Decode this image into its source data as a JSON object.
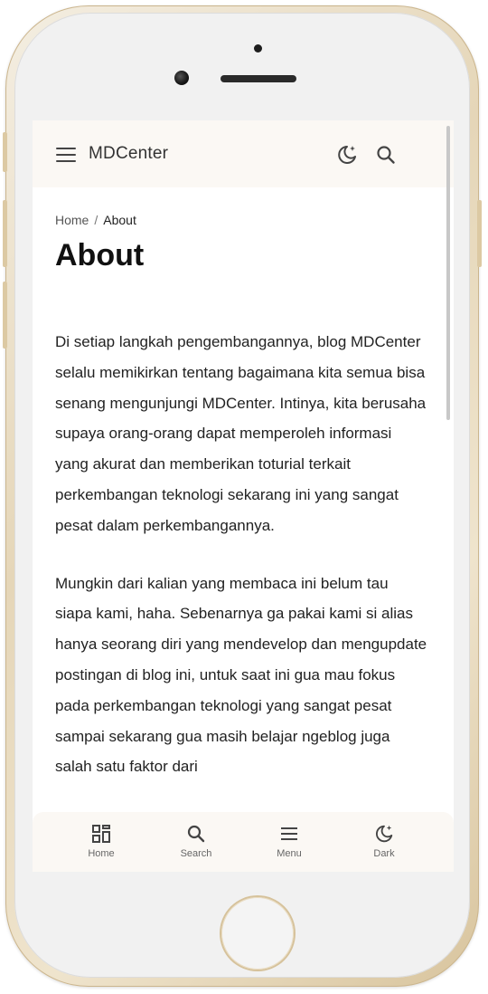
{
  "header": {
    "brand": "MDCenter",
    "icons": [
      "menu-icon",
      "dark-mode-icon",
      "search-icon"
    ]
  },
  "breadcrumb": {
    "home": "Home",
    "separator": "/",
    "current": "About"
  },
  "page": {
    "title": "About",
    "paragraphs": [
      "Di setiap langkah pengembangannya, blog MDCenter selalu memikirkan tentang bagaimana kita semua bisa senang mengunjungi MDCenter. Intinya, kita berusaha supaya orang-orang dapat memperoleh informasi yang akurat dan memberikan toturial terkait perkembangan teknologi sekarang ini yang sangat pesat dalam perkembangannya.",
      "Mungkin dari kalian yang membaca ini belum tau siapa kami, haha. Sebenarnya ga pakai kami si alias hanya seorang diri yang mendevelop dan mengupdate postingan di blog ini, untuk saat ini gua mau fokus pada perkembangan teknologi yang sangat pesat sampai sekarang gua masih belajar ngeblog juga salah satu faktor dari"
    ]
  },
  "bottom_nav": {
    "items": [
      {
        "label": "Home",
        "icon": "grid-icon"
      },
      {
        "label": "Search",
        "icon": "search-icon"
      },
      {
        "label": "Menu",
        "icon": "menu-icon"
      },
      {
        "label": "Dark",
        "icon": "dark-mode-icon"
      }
    ]
  },
  "colors": {
    "bar_background": "#fbf8f4",
    "text": "#222222",
    "phone_gold": "#e5d6b8"
  }
}
